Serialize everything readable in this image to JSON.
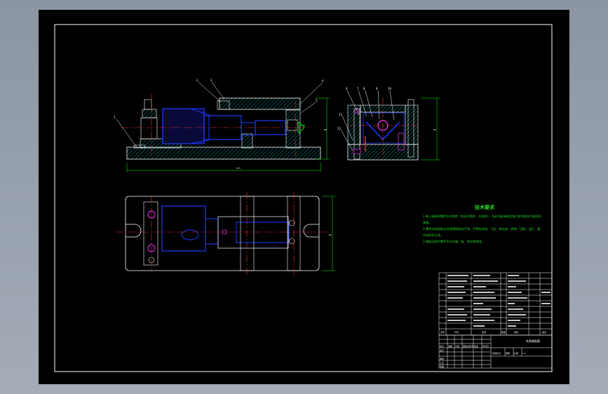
{
  "drawing": {
    "dim_overall_length": "573",
    "dim_height": "80",
    "dim_side_height": "83",
    "dim_plan_width": "60"
  },
  "balloons": {
    "front": [
      "1",
      "2",
      "3",
      "4",
      "5"
    ],
    "side": [
      "6",
      "7",
      "8",
      "9",
      "10",
      "11",
      "12"
    ]
  },
  "technical_requirements": {
    "title": "技术要求",
    "lines": [
      "1.装入装配的零件及外购件（包括外购件、外协件），均必须具有检验部门的合格证方能进行",
      "装配。",
      "2.零件在装配前必须清理和清洗干净，不得有毛刺、飞边、氧化皮、锈蚀、切屑、油污、着",
      "色剂和灰尘等。",
      "3.装配过程中零件不允许磕、碰、划伤和锈蚀。"
    ]
  },
  "title_block": {
    "header_labels": [
      "序号",
      "代号",
      "名称",
      "数量",
      "材料",
      "备注"
    ],
    "sheet_labels": [
      "标记",
      "处数",
      "分区",
      "更改文件号",
      "签名",
      "年月日"
    ],
    "approval_labels": [
      "设计",
      "审核",
      "工艺",
      "批准"
    ],
    "stage_labels": [
      "阶段标记",
      "重量",
      "比例"
    ],
    "drawing_name": "夹具装配图",
    "scale": "1:1"
  },
  "colors": {
    "background": "#000000",
    "outline": "#ffffff",
    "part": "#00ff00",
    "blue_part": "#1e3cff",
    "center_line": "#ff2a2a",
    "magenta": "#ff33ff",
    "hatch": "#00c8c8",
    "annotation_text": "#1fdc1f"
  }
}
